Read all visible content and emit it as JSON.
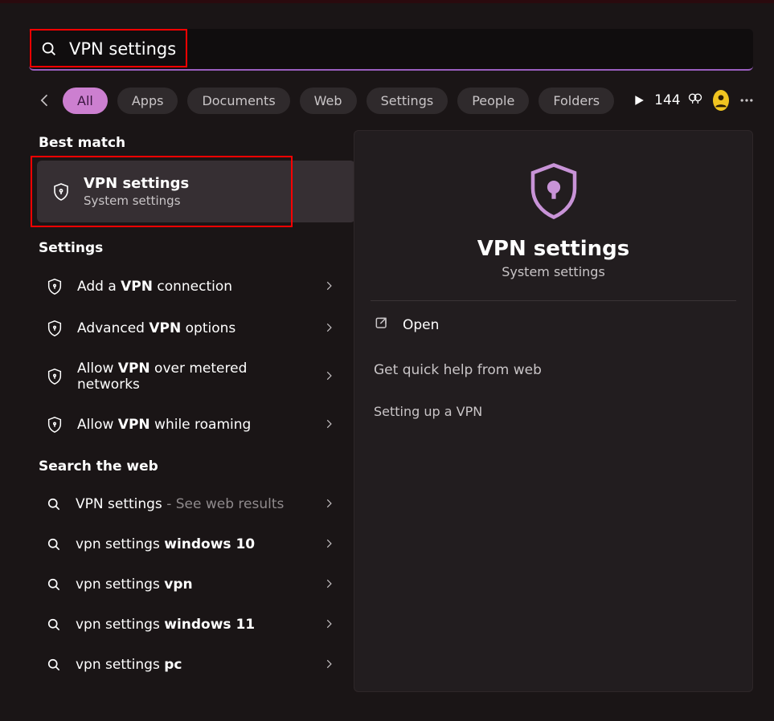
{
  "search": {
    "value": "VPN settings"
  },
  "filters": {
    "items": [
      {
        "label": "All",
        "active": true
      },
      {
        "label": "Apps"
      },
      {
        "label": "Documents"
      },
      {
        "label": "Web"
      },
      {
        "label": "Settings"
      },
      {
        "label": "People"
      },
      {
        "label": "Folders"
      }
    ]
  },
  "rewards": {
    "count": "144"
  },
  "results": {
    "best_match_hdr": "Best match",
    "best": {
      "title": "VPN settings",
      "sub": "System settings"
    },
    "settings_hdr": "Settings",
    "settings": [
      {
        "pre": "Add a ",
        "bold": "VPN",
        "post": " connection"
      },
      {
        "pre": "Advanced ",
        "bold": "VPN",
        "post": " options"
      },
      {
        "pre": "Allow ",
        "bold": "VPN",
        "post": " over metered networks"
      },
      {
        "pre": "Allow ",
        "bold": "VPN",
        "post": " while roaming"
      }
    ],
    "web_hdr": "Search the web",
    "web": [
      {
        "text": "VPN settings",
        "hint": " - See web results",
        "mode": "lead"
      },
      {
        "pre": "vpn settings ",
        "bold": "windows 10",
        "post": ""
      },
      {
        "pre": "vpn settings ",
        "bold": "vpn",
        "post": ""
      },
      {
        "pre": "vpn settings ",
        "bold": "windows 11",
        "post": ""
      },
      {
        "pre": "vpn settings ",
        "bold": "pc",
        "post": ""
      }
    ]
  },
  "preview": {
    "title": "VPN settings",
    "sub": "System settings",
    "open": "Open",
    "help_hdr": "Get quick help from web",
    "link1": "Setting up a VPN"
  }
}
